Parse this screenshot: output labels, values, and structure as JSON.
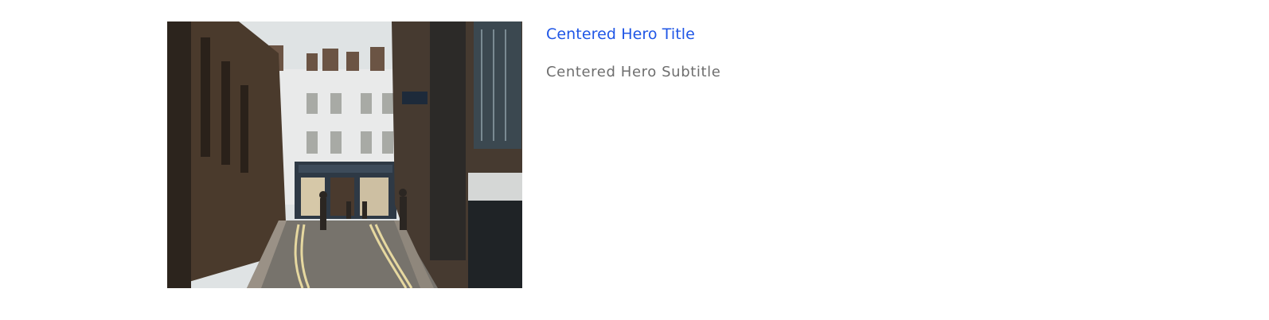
{
  "hero": {
    "title": "Centered Hero Title",
    "subtitle": "Centered Hero Subtitle",
    "image_alt": "Narrow city street with brick buildings and a shop at the end",
    "colors": {
      "title": "#1f56e6",
      "subtitle": "#6e6e6e"
    }
  }
}
